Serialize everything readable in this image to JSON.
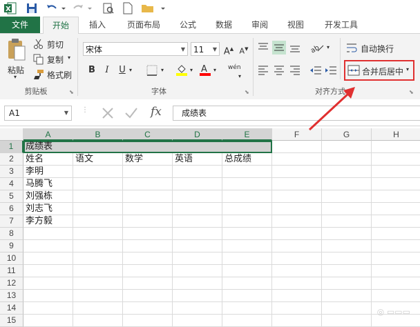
{
  "tabs": {
    "file": "文件",
    "items": [
      "开始",
      "插入",
      "页面布局",
      "公式",
      "数据",
      "审阅",
      "视图",
      "开发工具"
    ],
    "active": "开始"
  },
  "clipboard": {
    "paste": "粘贴",
    "cut": "剪切",
    "copy": "复制",
    "format_painter": "格式刷",
    "label": "剪贴板"
  },
  "font": {
    "name": "宋体",
    "size": "11",
    "label": "字体",
    "bold": "B",
    "italic": "I",
    "underline": "U",
    "phonetic": "wén",
    "font_color": "#ff0000",
    "fill_color": "#ffff00"
  },
  "alignment": {
    "wrap_text": "自动换行",
    "merge_center": "合并后居中",
    "label": "对齐方式"
  },
  "formula_bar": {
    "name_box": "A1",
    "fx": "fx",
    "content": "成绩表"
  },
  "columns": [
    "A",
    "B",
    "C",
    "D",
    "E",
    "F",
    "G",
    "H"
  ],
  "rows": [
    "1",
    "2",
    "3",
    "4",
    "5",
    "6",
    "7",
    "8",
    "9",
    "10",
    "11",
    "12",
    "13",
    "14",
    "15"
  ],
  "cells": {
    "A1": "成绩表",
    "A2": "姓名",
    "B2": "语文",
    "C2": "数学",
    "D2": "英语",
    "E2": "总成绩",
    "A3": "李明",
    "A4": "马腾飞",
    "A5": "刘强栋",
    "A6": "刘志飞",
    "A7": "李方毅"
  },
  "colors": {
    "excel_green": "#217346",
    "highlight_red": "#e03030"
  }
}
